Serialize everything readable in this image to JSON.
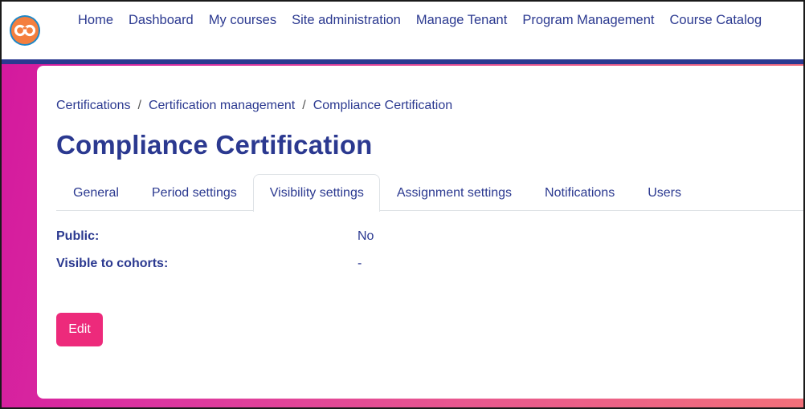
{
  "navbar": {
    "logo_icon": "infinity-link-logo",
    "links": [
      "Home",
      "Dashboard",
      "My courses",
      "Site administration",
      "Manage Tenant",
      "Program Management",
      "Course Catalog"
    ]
  },
  "breadcrumb": [
    "Certifications",
    "Certification management",
    "Compliance Certification"
  ],
  "breadcrumb_separator": "/",
  "page_title": "Compliance Certification",
  "tabs": [
    {
      "label": "General",
      "active": false
    },
    {
      "label": "Period settings",
      "active": false
    },
    {
      "label": "Visibility settings",
      "active": true
    },
    {
      "label": "Assignment settings",
      "active": false
    },
    {
      "label": "Notifications",
      "active": false
    },
    {
      "label": "Users",
      "active": false
    }
  ],
  "fields": [
    {
      "label": "Public:",
      "value": "No"
    },
    {
      "label": "Visible to cohorts:",
      "value": "-"
    }
  ],
  "edit_button_label": "Edit",
  "colors": {
    "brand_navy": "#2b3990",
    "accent_pink": "#ed2a7b",
    "logo_orange": "#f47f3e",
    "logo_ring": "#1e88c8"
  }
}
